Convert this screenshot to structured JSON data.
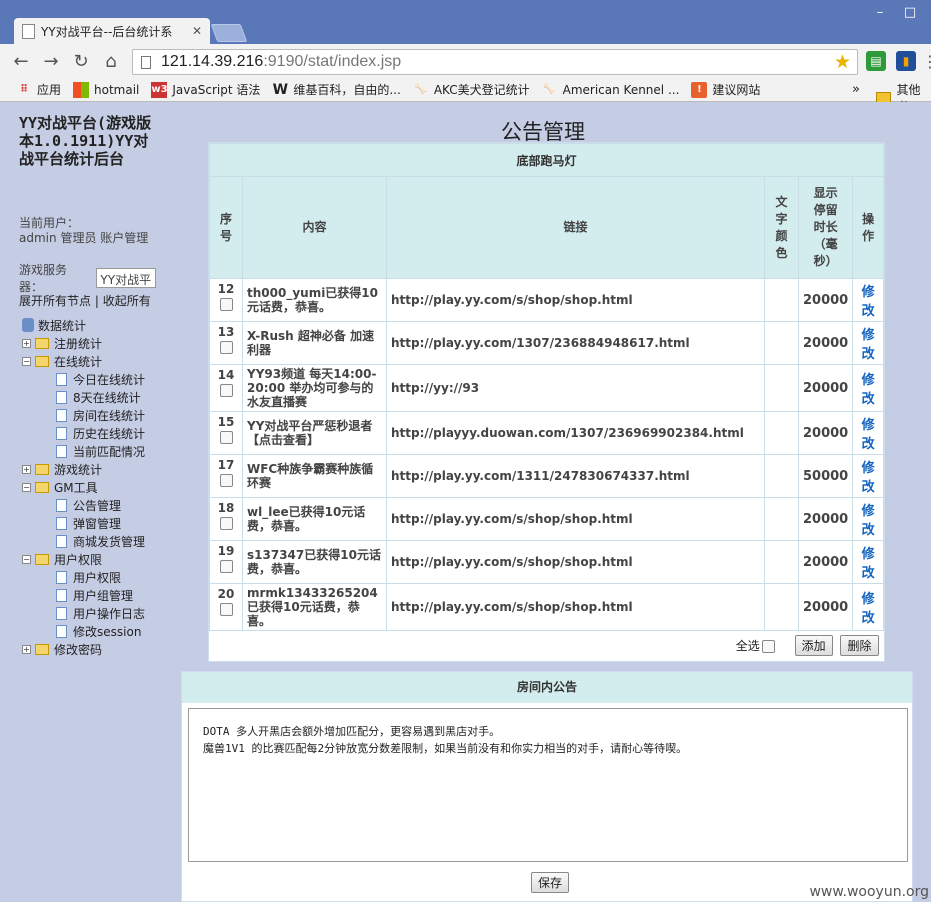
{
  "browser": {
    "tab_title": "YY对战平台--后台统计系",
    "url_host": "121.14.39.216",
    "url_path": ":9190/stat/index.jsp",
    "bookmarks": [
      {
        "label": "应用",
        "icon": "apps-grid-icon"
      },
      {
        "label": "hotmail",
        "icon": "windows-logo-icon"
      },
      {
        "label": "JavaScript 语法",
        "icon": "w3-icon"
      },
      {
        "label": "维基百科，自由的...",
        "icon": "wikipedia-icon"
      },
      {
        "label": "AKC美犬登记统计",
        "icon": "bone-icon"
      },
      {
        "label": "American Kennel ...",
        "icon": "bone-icon"
      },
      {
        "label": "建议网站",
        "icon": "bulb-icon"
      }
    ],
    "bookmarks_more": "»",
    "bookmarks_other": "其他书"
  },
  "sidebar": {
    "title": "YY对战平台(游戏版本1.0.1911)YY对战平台统计后台",
    "current_user_label": "当前用户：",
    "user_name": "admin",
    "user_role": "管理员",
    "account_link": "账户管理",
    "server_label": "游戏服务器：",
    "server_value": "YY对战平",
    "expand_all": "展开所有节点",
    "separator": "|",
    "collapse_all": "收起所有",
    "tree_root": "数据统计",
    "tree": [
      {
        "label": "注册统计",
        "level": 1,
        "expanded": false
      },
      {
        "label": "在线统计",
        "level": 1,
        "expanded": true
      },
      {
        "label": "今日在线统计",
        "level": 2
      },
      {
        "label": "8天在线统计",
        "level": 2
      },
      {
        "label": "房间在线统计",
        "level": 2
      },
      {
        "label": "历史在线统计",
        "level": 2
      },
      {
        "label": "当前匹配情况",
        "level": 2
      },
      {
        "label": "游戏统计",
        "level": 1,
        "expanded": false
      },
      {
        "label": "GM工具",
        "level": 1,
        "expanded": true
      },
      {
        "label": "公告管理",
        "level": 2
      },
      {
        "label": "弹窗管理",
        "level": 2
      },
      {
        "label": "商城发货管理",
        "level": 2
      },
      {
        "label": "用户权限",
        "level": 1,
        "expanded": true
      },
      {
        "label": "用户权限",
        "level": 2
      },
      {
        "label": "用户组管理",
        "level": 2
      },
      {
        "label": "用户操作日志",
        "level": 2
      },
      {
        "label": "修改session",
        "level": 2
      },
      {
        "label": "修改密码",
        "level": 1,
        "expanded": false
      }
    ]
  },
  "main": {
    "page_title": "公告管理",
    "marquee": {
      "caption": "底部跑马灯",
      "headers": [
        "序号",
        "内容",
        "链接",
        "文字颜色",
        "显示停留时长（毫秒）",
        "操作"
      ],
      "rows": [
        {
          "id": "12",
          "content": "th000_yumi已获得10元话费，恭喜。",
          "link": "http://play.yy.com/s/shop/shop.html",
          "color": "",
          "time": "20000",
          "op": "修改"
        },
        {
          "id": "13",
          "content": "X-Rush 超神必备 加速利器",
          "link": "http://play.yy.com/1307/236884948617.html",
          "color": "",
          "time": "20000",
          "op": "修改"
        },
        {
          "id": "14",
          "content": "YY93频道 每天14:00-20:00 举办均可参与的水友直播赛",
          "link": "http://yy://93",
          "color": "",
          "time": "20000",
          "op": "修改"
        },
        {
          "id": "15",
          "content": "YY对战平台严惩秒退者【点击查看】",
          "link": "http://playyy.duowan.com/1307/236969902384.html",
          "color": "",
          "time": "20000",
          "op": "修改"
        },
        {
          "id": "17",
          "content": "WFC种族争霸赛种族循环赛",
          "link": "http://play.yy.com/1311/247830674337.html",
          "color": "",
          "time": "50000",
          "op": "修改"
        },
        {
          "id": "18",
          "content": "wl_lee已获得10元话费，恭喜。",
          "link": "http://play.yy.com/s/shop/shop.html",
          "color": "",
          "time": "20000",
          "op": "修改"
        },
        {
          "id": "19",
          "content": "s137347已获得10元话费，恭喜。",
          "link": "http://play.yy.com/s/shop/shop.html",
          "color": "",
          "time": "20000",
          "op": "修改"
        },
        {
          "id": "20",
          "content": "mrmk13433265204已获得10元话费，恭喜。",
          "link": "http://play.yy.com/s/shop/shop.html",
          "color": "",
          "time": "20000",
          "op": "修改"
        }
      ],
      "select_all": "全选",
      "add_label": "添加",
      "delete_label": "删除"
    },
    "room": {
      "caption": "房间内公告",
      "line1": "DOTA 多人开黑店会额外增加匹配分，更容易遇到黑店对手。",
      "line2": "魔兽1V1 的比赛匹配每2分钟放宽分数差限制，如果当前没有和你实力相当的对手，请耐心等待喫。",
      "save_label": "保存"
    },
    "watermark": "www.wooyun.org"
  }
}
